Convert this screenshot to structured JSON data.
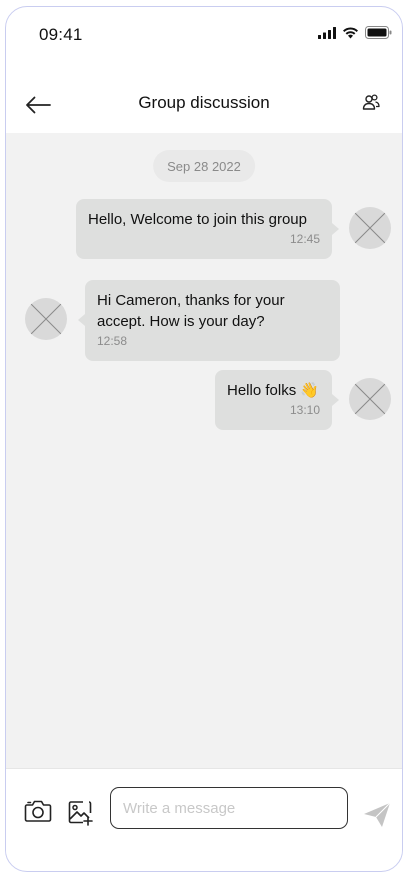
{
  "status_bar": {
    "time": "09:41"
  },
  "header": {
    "title": "Group discussion"
  },
  "chat": {
    "date": "Sep 28 2022",
    "messages": [
      {
        "side": "right",
        "lines": [
          "Hello, Welcome to join this group"
        ],
        "time": "12:45"
      },
      {
        "side": "left",
        "lines": [
          "Hi Cameron, thanks for your",
          "accept. How is your day?"
        ],
        "time": "12:58"
      },
      {
        "side": "right",
        "lines": [
          "Hello folks 👋"
        ],
        "time": "13:10"
      }
    ]
  },
  "composer": {
    "placeholder": "Write a message"
  },
  "icons": {
    "back": "arrow-left-icon",
    "members": "group-members-icon",
    "camera": "camera-icon",
    "gallery": "image-add-icon",
    "send": "send-icon"
  },
  "colors": {
    "chat_background": "#f2f2f2",
    "bubble": "#dedfde",
    "frame_border": "#c9cdf0"
  }
}
